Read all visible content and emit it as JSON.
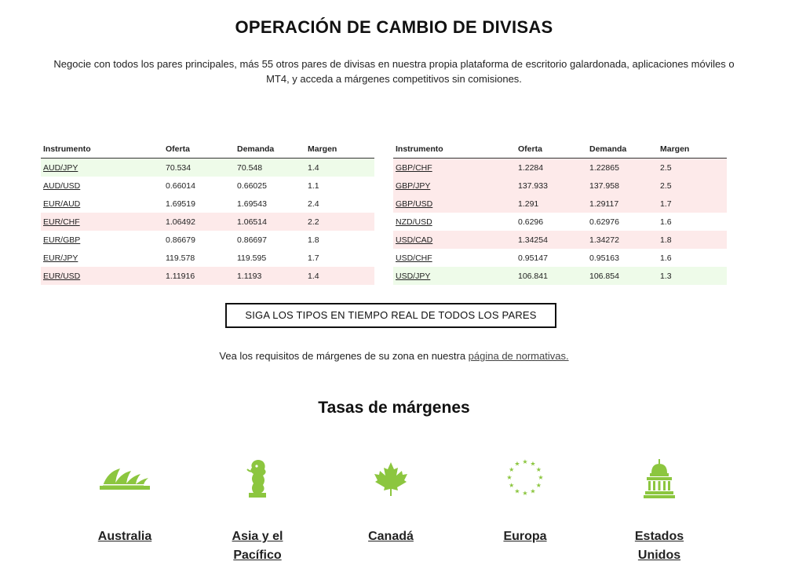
{
  "title": "OPERACIÓN DE CAMBIO DE DIVISAS",
  "intro": "Negocie con todos los pares principales, más 55 otros pares de divisas en nuestra propia plataforma de escritorio galardonada, aplicaciones móviles o MT4, y acceda a márgenes competitivos sin comisiones.",
  "table_headers": [
    "Instrumento",
    "Oferta",
    "Demanda",
    "Margen"
  ],
  "left_rows": [
    {
      "pair": "AUD/JPY",
      "bid": "70.534",
      "ask": "70.548",
      "spread": "1.4",
      "trend": "up"
    },
    {
      "pair": "AUD/USD",
      "bid": "0.66014",
      "ask": "0.66025",
      "spread": "1.1",
      "trend": "none"
    },
    {
      "pair": "EUR/AUD",
      "bid": "1.69519",
      "ask": "1.69543",
      "spread": "2.4",
      "trend": "none"
    },
    {
      "pair": "EUR/CHF",
      "bid": "1.06492",
      "ask": "1.06514",
      "spread": "2.2",
      "trend": "down"
    },
    {
      "pair": "EUR/GBP",
      "bid": "0.86679",
      "ask": "0.86697",
      "spread": "1.8",
      "trend": "none"
    },
    {
      "pair": "EUR/JPY",
      "bid": "119.578",
      "ask": "119.595",
      "spread": "1.7",
      "trend": "none"
    },
    {
      "pair": "EUR/USD",
      "bid": "1.11916",
      "ask": "1.1193",
      "spread": "1.4",
      "trend": "down"
    }
  ],
  "right_rows": [
    {
      "pair": "GBP/CHF",
      "bid": "1.2284",
      "ask": "1.22865",
      "spread": "2.5",
      "trend": "down"
    },
    {
      "pair": "GBP/JPY",
      "bid": "137.933",
      "ask": "137.958",
      "spread": "2.5",
      "trend": "down"
    },
    {
      "pair": "GBP/USD",
      "bid": "1.291",
      "ask": "1.29117",
      "spread": "1.7",
      "trend": "down"
    },
    {
      "pair": "NZD/USD",
      "bid": "0.6296",
      "ask": "0.62976",
      "spread": "1.6",
      "trend": "none"
    },
    {
      "pair": "USD/CAD",
      "bid": "1.34254",
      "ask": "1.34272",
      "spread": "1.8",
      "trend": "down"
    },
    {
      "pair": "USD/CHF",
      "bid": "0.95147",
      "ask": "0.95163",
      "spread": "1.6",
      "trend": "none"
    },
    {
      "pair": "USD/JPY",
      "bid": "106.841",
      "ask": "106.854",
      "spread": "1.3",
      "trend": "up"
    }
  ],
  "cta_label": "SIGA LOS TIPOS EN TIEMPO REAL DE TODOS LOS PARES",
  "note": {
    "text": "Vea los requisitos de márgenes de su zona en nuestra ",
    "link": "página de normativas."
  },
  "margins_title": "Tasas de márgenes",
  "regions": [
    {
      "label": "Australia",
      "icon": "opera-house-icon"
    },
    {
      "label": "Asia y el Pacífico",
      "icon": "merlion-icon"
    },
    {
      "label": "Canadá",
      "icon": "maple-leaf-icon"
    },
    {
      "label": "Europa",
      "icon": "eu-stars-icon"
    },
    {
      "label": "Estados Unidos",
      "icon": "capitol-icon"
    }
  ],
  "colors": {
    "accent": "#8cc63f",
    "up_row": "#eefbe9",
    "down_row": "#fdeaea"
  }
}
